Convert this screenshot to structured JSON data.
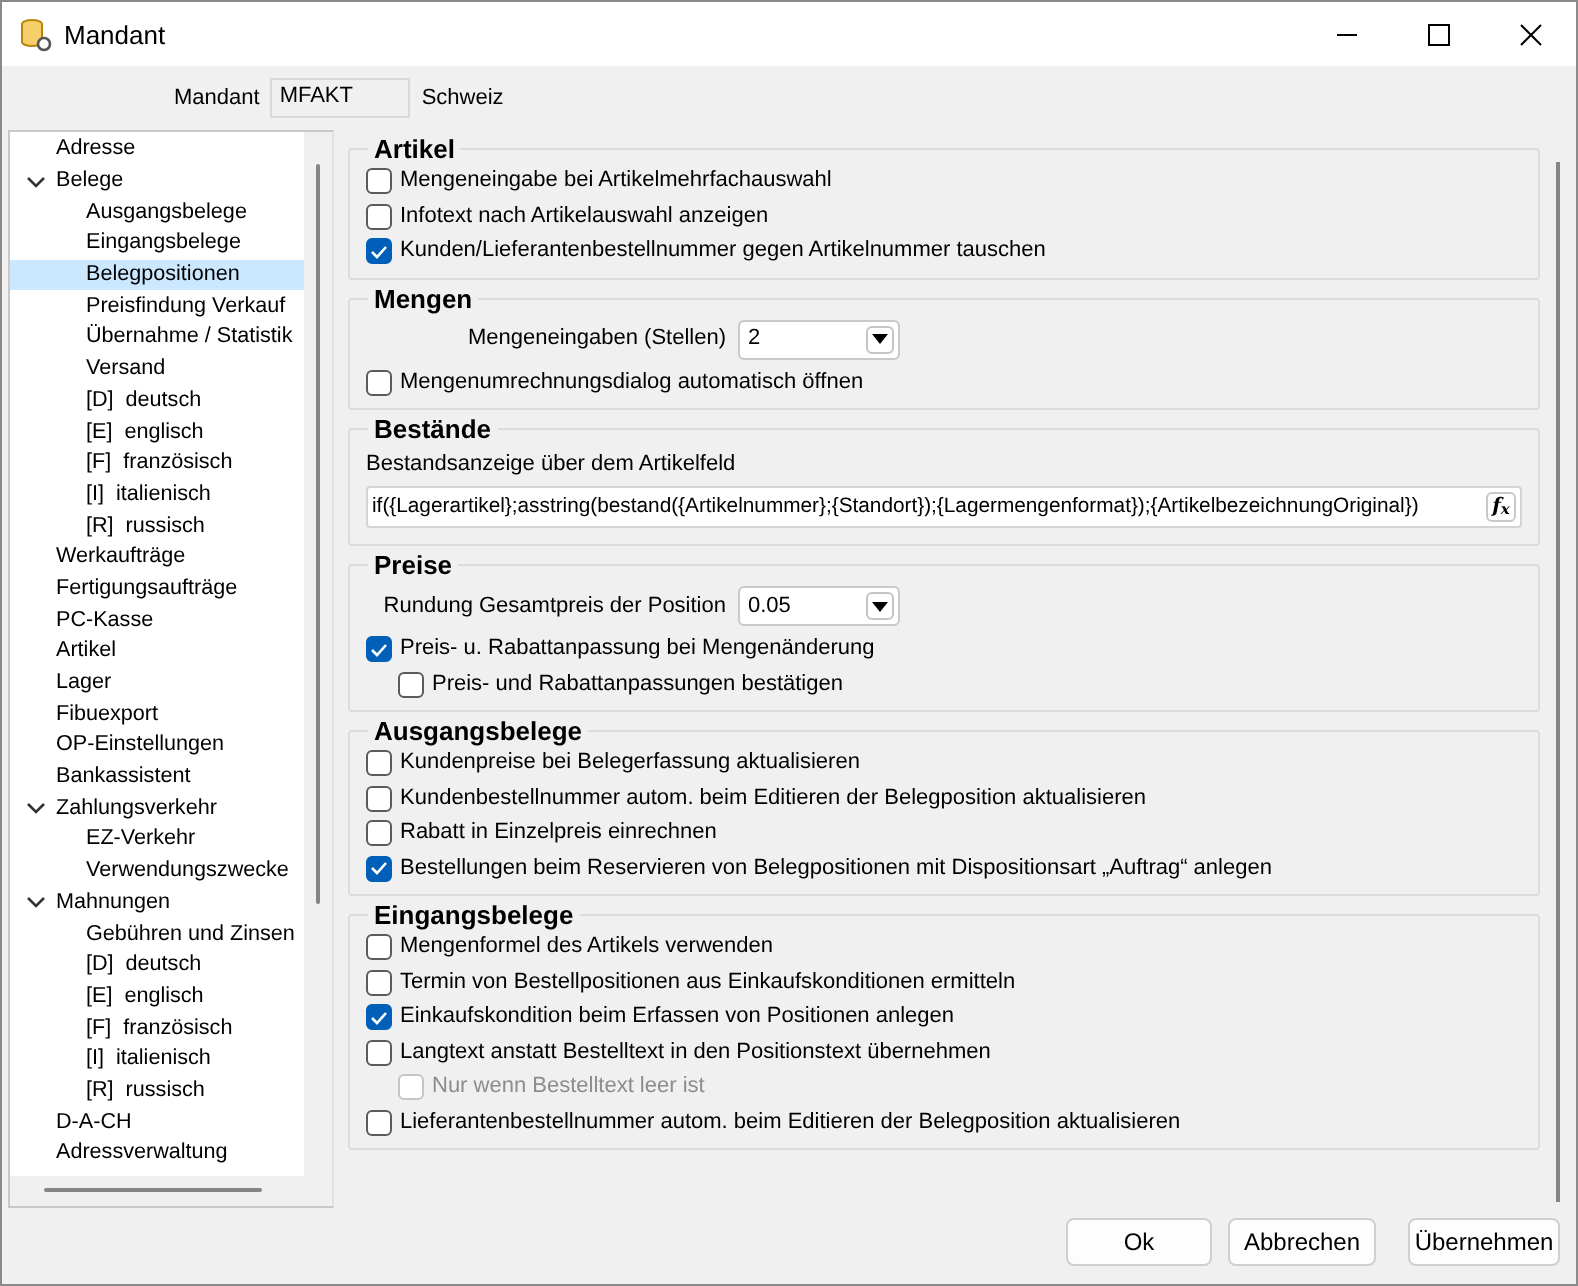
{
  "window": {
    "title": "Mandant"
  },
  "header": {
    "label": "Mandant",
    "value": "MFAKT",
    "name": "Schweiz"
  },
  "tree": [
    {
      "label": "Adresse",
      "selected": false
    },
    {
      "label": "Belege",
      "selected": false,
      "expanded": true,
      "children": [
        {
          "label": "Ausgangsbelege",
          "selected": false
        },
        {
          "label": "Eingangsbelege",
          "selected": false
        },
        {
          "label": "Belegpositionen",
          "selected": true
        },
        {
          "label": "Preisfindung Verkauf",
          "selected": false
        },
        {
          "label": "Übernahme / Statistik",
          "selected": false
        },
        {
          "label": "Versand",
          "selected": false
        },
        {
          "label": "[D]  deutsch",
          "selected": false
        },
        {
          "label": "[E]  englisch",
          "selected": false
        },
        {
          "label": "[F]  französisch",
          "selected": false
        },
        {
          "label": "[I]  italienisch",
          "selected": false
        },
        {
          "label": "[R]  russisch",
          "selected": false
        }
      ]
    },
    {
      "label": "Werkaufträge",
      "selected": false
    },
    {
      "label": "Fertigungsaufträge",
      "selected": false
    },
    {
      "label": "PC-Kasse",
      "selected": false
    },
    {
      "label": "Artikel",
      "selected": false
    },
    {
      "label": "Lager",
      "selected": false
    },
    {
      "label": "Fibuexport",
      "selected": false
    },
    {
      "label": "OP-Einstellungen",
      "selected": false
    },
    {
      "label": "Bankassistent",
      "selected": false
    },
    {
      "label": "Zahlungsverkehr",
      "selected": false,
      "expanded": true,
      "children": [
        {
          "label": "EZ-Verkehr",
          "selected": false
        },
        {
          "label": "Verwendungszwecke",
          "selected": false
        }
      ]
    },
    {
      "label": "Mahnungen",
      "selected": false,
      "expanded": true,
      "children": [
        {
          "label": "Gebühren und Zinsen",
          "selected": false
        },
        {
          "label": "[D]  deutsch",
          "selected": false
        },
        {
          "label": "[E]  englisch",
          "selected": false
        },
        {
          "label": "[F]  französisch",
          "selected": false
        },
        {
          "label": "[I]  italienisch",
          "selected": false
        },
        {
          "label": "[R]  russisch",
          "selected": false
        }
      ]
    },
    {
      "label": "D-A-CH",
      "selected": false
    },
    {
      "label": "Adressverwaltung",
      "selected": false
    }
  ],
  "sections": [
    {
      "title": "Artikel",
      "items": [
        {
          "kind": "checkbox",
          "label": "Mengeneingabe bei Artikelmehrfachauswahl",
          "checked": false,
          "disabled": false
        },
        {
          "kind": "checkbox",
          "label": "Infotext nach Artikelauswahl anzeigen",
          "checked": false,
          "disabled": false
        },
        {
          "kind": "checkbox",
          "label": "Kunden/Lieferantenbestellnummer gegen Artikelnummer tauschen",
          "checked": true,
          "disabled": false
        }
      ]
    },
    {
      "title": "Mengen",
      "items": [
        {
          "kind": "select",
          "label": "Mengeneingaben (Stellen)",
          "value": "2"
        },
        {
          "kind": "checkbox",
          "label": "Mengenumrechnungsdialog automatisch öffnen",
          "checked": false,
          "disabled": false
        }
      ]
    },
    {
      "title": "Bestände",
      "items": [
        {
          "kind": "text",
          "label": "Bestandsanzeige über dem Artikelfeld"
        },
        {
          "kind": "formula",
          "value": "if({Lagerartikel};asstring(bestand({Artikelnummer};{Standort});{Lagermengenformat});{ArtikelbezeichnungOriginal})",
          "button": "f$_{x}$"
        }
      ]
    },
    {
      "title": "Preise",
      "items": [
        {
          "kind": "select",
          "label": "Rundung Gesamtpreis der Position",
          "value": "0.05"
        },
        {
          "kind": "checkbox",
          "label": "Preis- u. Rabattanpassung bei Mengenänderung",
          "checked": true,
          "disabled": false,
          "children": [
            {
              "kind": "checkbox",
              "label": "Preis- und Rabattanpassungen bestätigen",
              "checked": false,
              "disabled": false
            }
          ]
        }
      ]
    },
    {
      "title": "Ausgangsbelege",
      "items": [
        {
          "kind": "checkbox",
          "label": "Kundenpreise bei Belegerfassung aktualisieren",
          "checked": false,
          "disabled": false
        },
        {
          "kind": "checkbox",
          "label": "Kundenbestellnummer autom. beim Editieren der Belegposition aktualisieren",
          "checked": false,
          "disabled": false
        },
        {
          "kind": "checkbox",
          "label": "Rabatt in Einzelpreis einrechnen",
          "checked": false,
          "disabled": false
        },
        {
          "kind": "checkbox",
          "label": "Bestellungen beim Reservieren von Belegpositionen mit Dispositionsart „Auftrag“ anlegen",
          "checked": true,
          "disabled": false
        }
      ]
    },
    {
      "title": "Eingangsbelege",
      "items": [
        {
          "kind": "checkbox",
          "label": "Mengenformel des Artikels verwenden",
          "checked": false,
          "disabled": false
        },
        {
          "kind": "checkbox",
          "label": "Termin von Bestellpositionen aus Einkaufskonditionen ermitteln",
          "checked": false,
          "disabled": false
        },
        {
          "kind": "checkbox",
          "label": "Einkaufskondition beim Erfassen von Positionen anlegen",
          "checked": true,
          "disabled": false
        },
        {
          "kind": "checkbox",
          "label": "Langtext anstatt Bestelltext in den Positionstext übernehmen",
          "checked": false,
          "disabled": false,
          "children": [
            {
              "kind": "checkbox",
              "label": "Nur wenn Bestelltext leer ist",
              "checked": false,
              "disabled": true
            }
          ]
        },
        {
          "kind": "checkbox",
          "label": "Lieferantenbestellnummer autom. beim Editieren der Belegposition aktualisieren",
          "checked": false,
          "disabled": false
        }
      ]
    }
  ],
  "buttons": [
    "Ok",
    "Abbrechen",
    "Übernehmen"
  ]
}
